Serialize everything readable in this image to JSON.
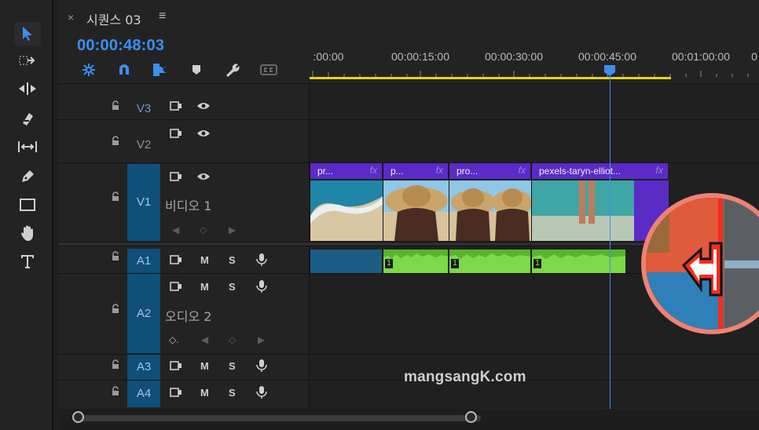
{
  "sequence_tab": {
    "close": "×",
    "title": "시퀀스 03",
    "menu": "≡"
  },
  "timecode": "00:00:48:03",
  "ruler": {
    "labels": [
      ":00:00",
      "00:00:15:00",
      "00:00:30:00",
      "00:00:45:00",
      "00:01:00:00",
      "0"
    ]
  },
  "tracks": {
    "v3": {
      "name": "V3"
    },
    "v2": {
      "name": "V2"
    },
    "v1": {
      "name": "V1",
      "label": "비디오 1"
    },
    "a1": {
      "name": "A1",
      "m": "M",
      "s": "S"
    },
    "a2": {
      "name": "A2",
      "label": "오디오 2",
      "m": "M",
      "s": "S"
    },
    "a3": {
      "name": "A3",
      "m": "M",
      "s": "S"
    },
    "a4": {
      "name": "A4",
      "m": "M",
      "s": "S"
    }
  },
  "clips": {
    "video": [
      {
        "title": "pr...",
        "fx": "fx"
      },
      {
        "title": "p...",
        "fx": "fx"
      },
      {
        "title": "pro...",
        "fx": "fx"
      },
      {
        "title": "pexels-taryn-elliot...",
        "fx": "fx"
      }
    ],
    "audio_marker": "1"
  },
  "watermark": "mangsangK.com",
  "icons": {
    "tools": [
      "selection-tool-icon",
      "track-select-icon",
      "ripple-edit-icon",
      "razor-icon",
      "slip-icon",
      "pen-icon",
      "rectangle-icon",
      "hand-icon",
      "type-icon"
    ],
    "timeline_controls": [
      "snap-nest-icon",
      "magnet-icon",
      "linked-selection-icon",
      "marker-icon",
      "wrench-icon",
      "captions-icon"
    ]
  },
  "colors": {
    "accent": "#3b8ff0",
    "work_area": "#e8d21c",
    "video_clip": "#5a2bc7",
    "audio_clip": "#58b52c",
    "magnifier_ring": "#f08272",
    "track_selected": "#0f4f7a"
  }
}
